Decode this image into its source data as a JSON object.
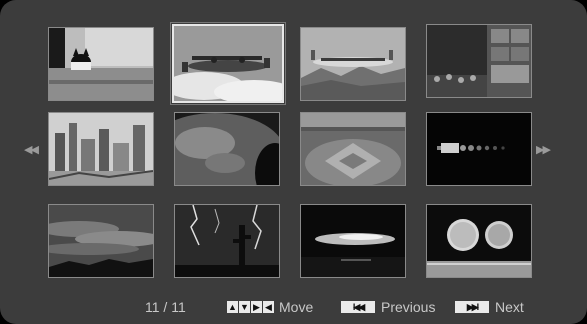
{
  "viewer": {
    "page_counter": "11 / 11",
    "nav_left_icon": "double-chevron-left-icon",
    "nav_right_icon": "double-chevron-right-icon",
    "selected_index": 1,
    "thumbnails": [
      {
        "subject": "cat-on-ledge"
      },
      {
        "subject": "airplane-in-flight"
      },
      {
        "subject": "airliner-over-mountains"
      },
      {
        "subject": "concert-stage-speakers"
      },
      {
        "subject": "industrial-cityscape"
      },
      {
        "subject": "earth-from-space"
      },
      {
        "subject": "baseball-stadium"
      },
      {
        "subject": "rocket-launch"
      },
      {
        "subject": "cloudy-sky"
      },
      {
        "subject": "lightning-desert"
      },
      {
        "subject": "sunset-cloud"
      },
      {
        "subject": "two-coins"
      }
    ]
  },
  "controls": {
    "move_label": "Move",
    "previous_label": "Previous",
    "next_label": "Next",
    "move_keys": [
      "▲",
      "▼",
      "▶",
      "◀"
    ],
    "previous_key": "I◀◀",
    "next_key": "▶▶I"
  }
}
